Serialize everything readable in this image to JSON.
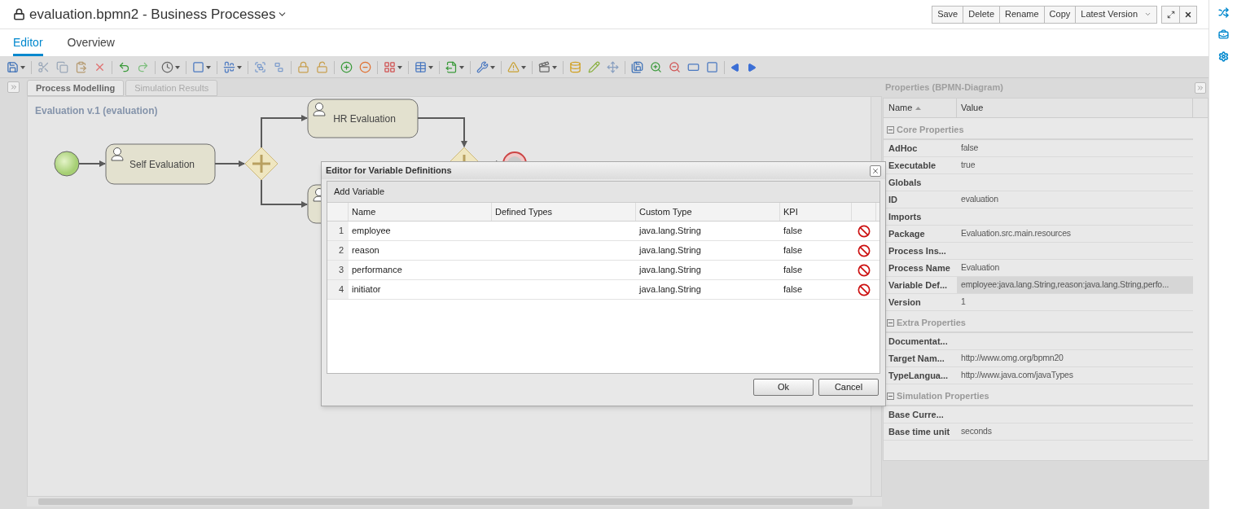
{
  "header": {
    "title": "evaluation.bpmn2 - Business Processes",
    "buttons": [
      "Save",
      "Delete",
      "Rename",
      "Copy"
    ],
    "version_menu": "Latest Version"
  },
  "tabs": [
    {
      "label": "Editor",
      "selected": true
    },
    {
      "label": "Overview",
      "selected": false
    }
  ],
  "editor_tabs": [
    {
      "label": "Process Modelling",
      "selected": true
    },
    {
      "label": "Simulation Results",
      "selected": false
    }
  ],
  "diagram": {
    "title": "Evaluation v.1 (evaluation)",
    "tasks": [
      "Self Evaluation",
      "HR Evaluation"
    ]
  },
  "dialog": {
    "title": "Editor for Variable Definitions",
    "add_button": "Add Variable",
    "columns": [
      "Name",
      "Defined Types",
      "Custom Type",
      "KPI"
    ],
    "rows": [
      {
        "index": "1",
        "name": "employee",
        "custom_type": "java.lang.String",
        "kpi": "false"
      },
      {
        "index": "2",
        "name": "reason",
        "custom_type": "java.lang.String",
        "kpi": "false"
      },
      {
        "index": "3",
        "name": "performance",
        "custom_type": "java.lang.String",
        "kpi": "false"
      },
      {
        "index": "4",
        "name": "initiator",
        "custom_type": "java.lang.String",
        "kpi": "false"
      }
    ],
    "buttons": [
      "Ok",
      "Cancel"
    ]
  },
  "properties": {
    "title": "Properties (BPMN-Diagram)",
    "columns": [
      "Name",
      "Value"
    ],
    "groups": [
      {
        "title": "Core Properties",
        "expanded": true,
        "rows": [
          {
            "name": "AdHoc",
            "value": "false",
            "selected": false
          },
          {
            "name": "Executable",
            "value": "true",
            "selected": false
          },
          {
            "name": "Globals",
            "selected": false
          },
          {
            "name": "ID",
            "value": "evaluation",
            "selected": false
          },
          {
            "name": "Imports",
            "selected": false
          },
          {
            "name": "Package",
            "value": "Evaluation.src.main.resources",
            "selected": false
          },
          {
            "name": "Process Ins...",
            "selected": false
          },
          {
            "name": "Process Name",
            "value": "Evaluation",
            "selected": false
          },
          {
            "name": "Variable Def...",
            "value": "employee:java.lang.String,reason:java.lang.String,perfo...",
            "selected": true
          },
          {
            "name": "Version",
            "value": "1",
            "selected": false
          }
        ]
      },
      {
        "title": "Extra Properties",
        "expanded": true,
        "rows": [
          {
            "name": "Documentat...",
            "selected": false
          },
          {
            "name": "Target Nam...",
            "value": "http://www.omg.org/bpmn20",
            "selected": false
          },
          {
            "name": "TypeLangua...",
            "value": "http://www.java.com/javaTypes",
            "selected": false
          }
        ]
      },
      {
        "title": "Simulation Properties",
        "expanded": true,
        "rows": [
          {
            "name": "Base Curre...",
            "selected": false
          },
          {
            "name": "Base time unit",
            "value": "seconds",
            "selected": false
          }
        ]
      }
    ]
  }
}
